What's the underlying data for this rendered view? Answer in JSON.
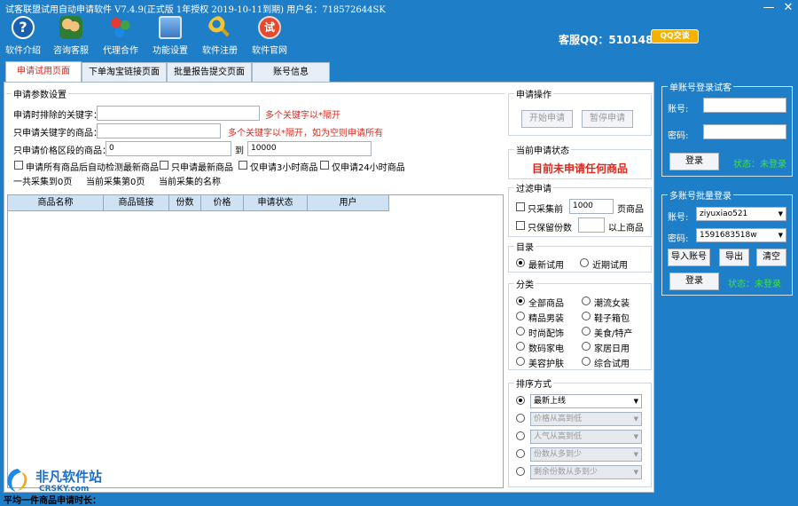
{
  "window": {
    "title": "试客联盟试用自动申请软件 V7.4.9(正式版 1年授权 2019-10-11到期) 用户名：718572644SK",
    "minimize": "—",
    "close": "✕"
  },
  "toolbar": [
    {
      "label": "软件介绍",
      "icon": "question-icon"
    },
    {
      "label": "咨询客服",
      "icon": "users-icon"
    },
    {
      "label": "代理合作",
      "icon": "share-icon"
    },
    {
      "label": "功能设置",
      "icon": "computer-icon"
    },
    {
      "label": "软件注册",
      "icon": "key-icon"
    },
    {
      "label": "软件官网",
      "icon": "try-icon"
    }
  ],
  "service": {
    "text": "客服QQ：510148694",
    "qq_btn": "QQ交谈"
  },
  "tabs": [
    "申请试用页面",
    "下单淘宝链接页面",
    "批量报告提交页面",
    "账号信息"
  ],
  "params": {
    "title": "申请参数设置",
    "exclude_label": "申请时排除的关键字：",
    "exclude_hint": "多个关键字以*隔开",
    "include_label": "只申请关键字的商品：",
    "include_hint": "多个关键字以*隔开，如为空则申请所有",
    "price_label": "只申请价格区段的商品：",
    "price_min": "0",
    "price_to": "到",
    "price_max": "10000",
    "cb1": "申请所有商品后自动检测最新商品",
    "cb2": "只申请最新商品",
    "cb3": "仅申请3小时商品",
    "cb4": "仅申请24小时商品",
    "total_pages": "一共采集到0页",
    "current_page": "当前采集第0页",
    "current_name": "当前采集的名称"
  },
  "grid": {
    "columns": [
      "商品名称",
      "商品链接",
      "份数",
      "价格",
      "申请状态",
      "用户"
    ]
  },
  "operation": {
    "title": "申请操作",
    "start": "开始申请",
    "pause": "暂停申请"
  },
  "status": {
    "title": "当前申请状态",
    "text": "目前未申请任何商品"
  },
  "filter": {
    "title": "过滤申请",
    "cb_pages": "只采集前",
    "pages_value": "1000",
    "pages_unit": "页商品",
    "cb_copies": "只保留份数",
    "copies_value": "",
    "copies_unit": "以上商品"
  },
  "catalog": {
    "title": "目录",
    "opt1": "最新试用",
    "opt2": "近期试用",
    "selected": "最新试用"
  },
  "category": {
    "title": "分类",
    "left": [
      "全部商品",
      "精品男装",
      "时尚配饰",
      "数码家电",
      "美容护肤"
    ],
    "right": [
      "潮流女装",
      "鞋子箱包",
      "美食/特产",
      "家居日用",
      "综合试用"
    ],
    "selected": "全部商品"
  },
  "sort": {
    "title": "排序方式",
    "options": [
      "最新上线",
      "价格从高到低",
      "人气从高到低",
      "份数从多到少",
      "剩余份数从多到少"
    ],
    "selected": "最新上线"
  },
  "single_login": {
    "title": "单账号登录试客",
    "account_label": "账号:",
    "account_value": "",
    "password_label": "密码:",
    "password_value": "",
    "login": "登录",
    "status": "状态：未登录"
  },
  "multi_login": {
    "title": "多账号批量登录",
    "account_label": "账号:",
    "account_value": "ziyuxiao521",
    "password_label": "密码:",
    "password_value": "1591683518w",
    "import": "导入账号",
    "export": "导出",
    "clear": "清空",
    "login": "登录",
    "status": "状态：未登录"
  },
  "watermark": {
    "name": "非凡软件站",
    "site": "CRSKY.com"
  },
  "bottom": {
    "text": "平均一件商品申请时长："
  },
  "colors": {
    "titlebar": "#1e7ec8",
    "red_text": "#e1261c",
    "green_status": "#3ee13e"
  }
}
